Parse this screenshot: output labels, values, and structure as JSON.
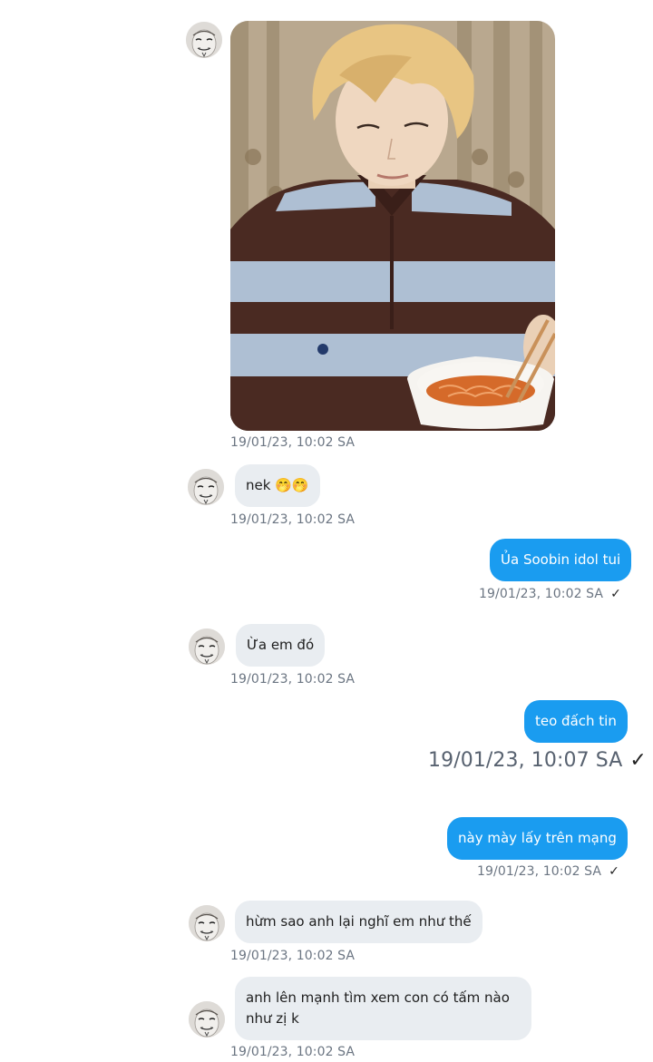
{
  "messages": [
    {
      "id": "m1",
      "side": "in",
      "type": "photo",
      "time": "19/01/23,  10:02 SA"
    },
    {
      "id": "m2",
      "side": "in",
      "type": "text",
      "text": "nek 🤭🤭",
      "time": "19/01/23,  10:02 SA"
    },
    {
      "id": "m3",
      "side": "out",
      "type": "text",
      "text": "Ủa Soobin idol tui",
      "time": "19/01/23,  10:02 SA"
    },
    {
      "id": "m4",
      "side": "in",
      "type": "text",
      "text": "Ừa em đó",
      "time": "19/01/23,  10:02 SA"
    },
    {
      "id": "m5",
      "side": "out",
      "type": "text",
      "text": "teo đấch tin",
      "time": "19/01/23,  10:07 SA"
    },
    {
      "id": "m6",
      "side": "out",
      "type": "text",
      "text": "này mày lấy trên mạng",
      "time": "19/01/23,  10:02 SA"
    },
    {
      "id": "m7",
      "side": "in",
      "type": "text",
      "text": "hừm sao anh lại nghĩ em như thế",
      "time": "19/01/23,  10:02 SA"
    },
    {
      "id": "m8",
      "side": "in",
      "type": "text",
      "text": "anh lên mạnh tìm xem con có tấm nào như zị k",
      "time": "19/01/23,  10:02 SA"
    }
  ],
  "icons": {
    "sent": "checkmark-icon",
    "avatar": "mask-avatar-icon"
  },
  "colors": {
    "outgoing_bubble": "#1a9cf0",
    "incoming_bubble": "#e9edf1",
    "timestamp": "#6b7582",
    "background": "#ffffff"
  }
}
